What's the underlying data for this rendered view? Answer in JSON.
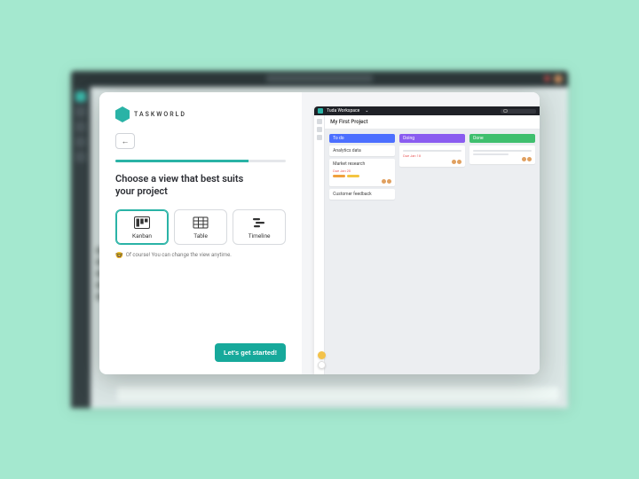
{
  "brand": {
    "name": "TASKWORLD",
    "mark": "TW"
  },
  "wizard": {
    "progress_pct": 78,
    "heading": "Choose a view that best suits your project",
    "hint_emoji": "🤓",
    "hint_text": "Of course! You can change the view anytime.",
    "cta_label": "Let's get started!",
    "views": [
      {
        "key": "kanban",
        "label": "Kanban",
        "selected": true
      },
      {
        "key": "table",
        "label": "Table",
        "selected": false
      },
      {
        "key": "timeline",
        "label": "Timeline",
        "selected": false
      }
    ]
  },
  "preview": {
    "workspace_name": "Tuda Workspace",
    "project_title": "My First Project",
    "columns": {
      "todo": {
        "label": "To do"
      },
      "doing": {
        "label": "Doing"
      },
      "done": {
        "label": "Done"
      }
    },
    "cards": {
      "todo": [
        {
          "title": "Analytics data"
        },
        {
          "title": "Market research",
          "due": "Due Jan 20",
          "tags": 2
        },
        {
          "title": "Customer feedback"
        }
      ],
      "doing": [
        {
          "title": "",
          "due": "Due Jan 18",
          "avatars": 2
        }
      ],
      "done": [
        {
          "title": "",
          "avatars": 2
        }
      ]
    }
  },
  "colors": {
    "accent": "#2ab3a6",
    "col_todo": "#4c6fff",
    "col_doing": "#8a5cf0",
    "col_done": "#3fbf6e"
  }
}
